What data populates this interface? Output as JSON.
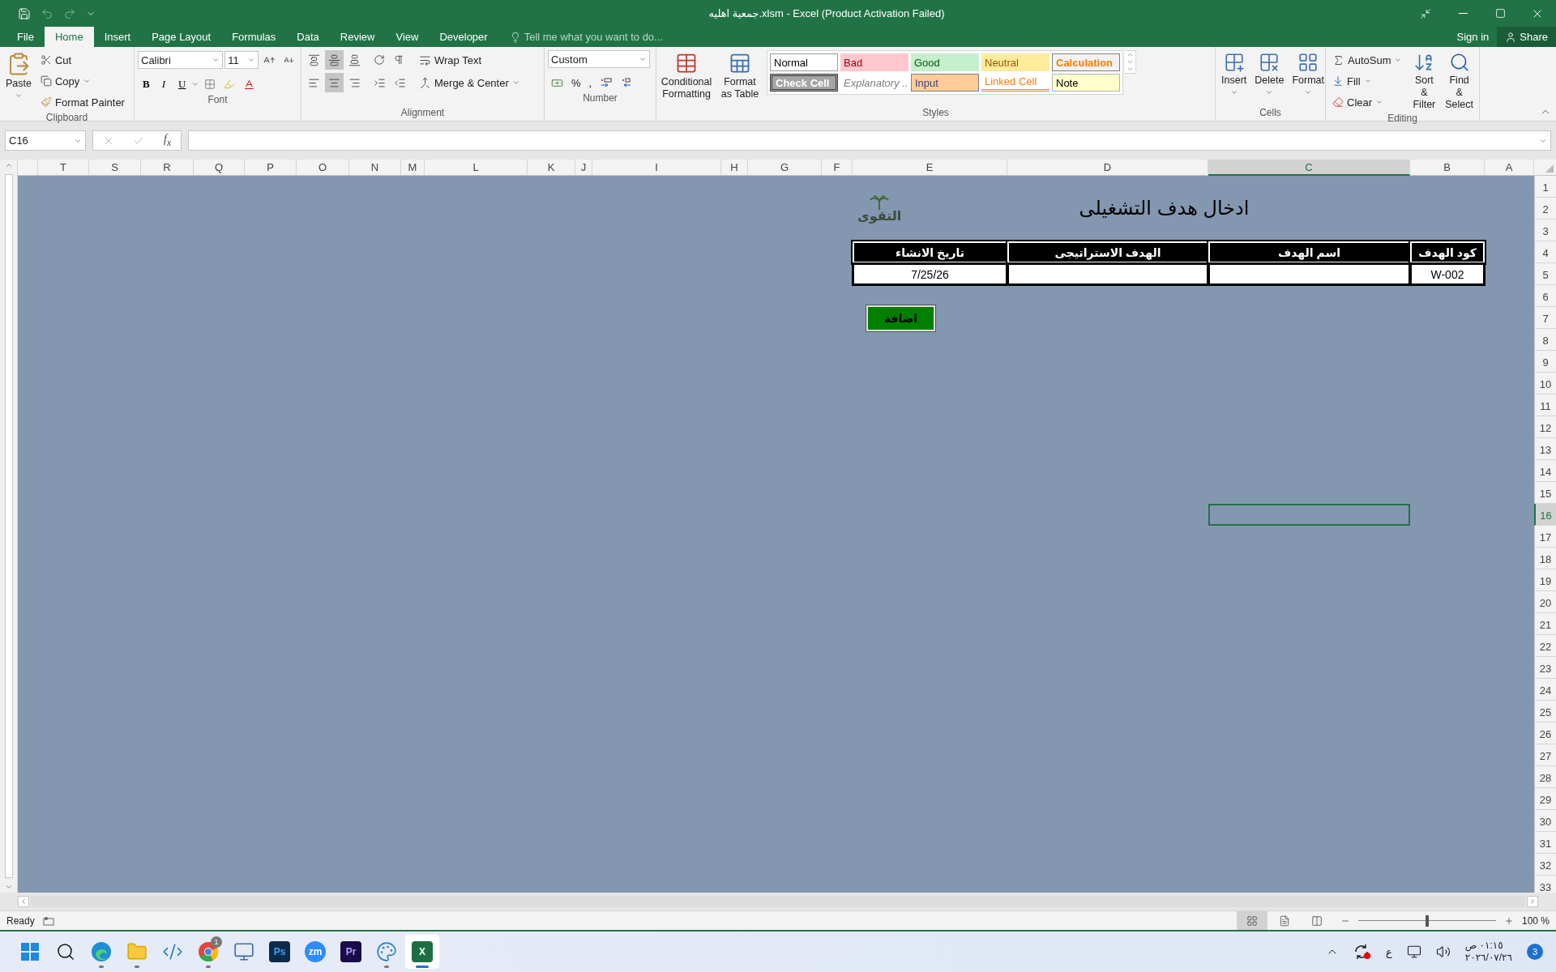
{
  "window": {
    "title": "جمعية اهليه.xlsm - Excel (Product Activation Failed)"
  },
  "quick_access": [
    {
      "kind": "save",
      "disabled": false
    },
    {
      "kind": "undo",
      "disabled": true
    },
    {
      "kind": "redo",
      "disabled": true
    },
    {
      "kind": "customize",
      "disabled": false
    }
  ],
  "ribbon_tabs": [
    {
      "label": "File",
      "selected": false
    },
    {
      "label": "Home",
      "selected": true
    },
    {
      "label": "Insert",
      "selected": false
    },
    {
      "label": "Page Layout",
      "selected": false
    },
    {
      "label": "Formulas",
      "selected": false
    },
    {
      "label": "Data",
      "selected": false
    },
    {
      "label": "Review",
      "selected": false
    },
    {
      "label": "View",
      "selected": false
    },
    {
      "label": "Developer",
      "selected": false
    }
  ],
  "tell_me": {
    "placeholder": "Tell me what you want to do..."
  },
  "account": {
    "sign_in": "Sign in",
    "share": "Share"
  },
  "ribbon": {
    "clipboard": {
      "label": "Clipboard",
      "paste": "Paste",
      "cut": "Cut",
      "copy": "Copy",
      "format_painter": "Format Painter"
    },
    "font": {
      "label": "Font",
      "name": "Calibri",
      "size": "11",
      "bold": "B",
      "italic": "I",
      "underline": "U"
    },
    "alignment": {
      "label": "Alignment",
      "wrap_text": "Wrap Text",
      "merge": "Merge & Center",
      "vertical": [
        {
          "kind": "top",
          "selected": false
        },
        {
          "kind": "middle",
          "selected": true
        },
        {
          "kind": "bottom",
          "selected": false
        }
      ],
      "horizontal": [
        {
          "kind": "left",
          "selected": false
        },
        {
          "kind": "center",
          "selected": true
        },
        {
          "kind": "right",
          "selected": false
        }
      ]
    },
    "number": {
      "label": "Number",
      "format": "Custom",
      "percent": "%",
      "comma": ","
    },
    "styles": {
      "label": "Styles",
      "conditional": "Conditional Formatting",
      "format_table": "Format as Table",
      "gallery": [
        {
          "label": "Normal",
          "kind": "normal"
        },
        {
          "label": "Bad",
          "kind": "bad"
        },
        {
          "label": "Good",
          "kind": "good"
        },
        {
          "label": "Neutral",
          "kind": "neutral"
        },
        {
          "label": "Calculation",
          "kind": "calculation"
        },
        {
          "label": "Check Cell",
          "kind": "check"
        },
        {
          "label": "Explanatory ...",
          "kind": "explanatory"
        },
        {
          "label": "Input",
          "kind": "input"
        },
        {
          "label": "Linked Cell",
          "kind": "linked"
        },
        {
          "label": "Note",
          "kind": "note"
        }
      ]
    },
    "cells": {
      "label": "Cells",
      "buttons": [
        {
          "label": "Insert",
          "kind": "insert"
        },
        {
          "label": "Delete",
          "kind": "delete"
        },
        {
          "label": "Format",
          "kind": "format"
        }
      ]
    },
    "editing": {
      "label": "Editing",
      "autosum": "AutoSum",
      "fill": "Fill",
      "clear": "Clear",
      "sort": "Sort & Filter",
      "find": "Find & Select"
    }
  },
  "formula_bar": {
    "name_box": "C16",
    "function": "f$_{x}$"
  },
  "sheet": {
    "columns": [
      {
        "letter": "T",
        "selected": false
      },
      {
        "letter": "S",
        "selected": false
      },
      {
        "letter": "R",
        "selected": false
      },
      {
        "letter": "Q",
        "selected": false
      },
      {
        "letter": "P",
        "selected": false
      },
      {
        "letter": "O",
        "selected": false
      },
      {
        "letter": "N",
        "selected": false
      },
      {
        "letter": "M",
        "selected": false
      },
      {
        "letter": "L",
        "selected": false
      },
      {
        "letter": "K",
        "selected": false
      },
      {
        "letter": "J",
        "selected": false
      },
      {
        "letter": "I",
        "selected": false
      },
      {
        "letter": "H",
        "selected": false
      },
      {
        "letter": "G",
        "selected": false
      },
      {
        "letter": "F",
        "selected": false
      },
      {
        "letter": "E",
        "selected": false
      },
      {
        "letter": "D",
        "selected": false
      },
      {
        "letter": "C",
        "selected": true
      },
      {
        "letter": "B",
        "selected": false
      },
      {
        "letter": "A",
        "selected": false
      }
    ],
    "rows": [
      {
        "number": "1",
        "selected": false
      },
      {
        "number": "2",
        "selected": false
      },
      {
        "number": "3",
        "selected": false
      },
      {
        "number": "4",
        "selected": false
      },
      {
        "number": "5",
        "selected": false
      },
      {
        "number": "6",
        "selected": false
      },
      {
        "number": "7",
        "selected": false
      },
      {
        "number": "8",
        "selected": false
      },
      {
        "number": "9",
        "selected": false
      },
      {
        "number": "10",
        "selected": false
      },
      {
        "number": "11",
        "selected": false
      },
      {
        "number": "12",
        "selected": false
      },
      {
        "number": "13",
        "selected": false
      },
      {
        "number": "14",
        "selected": false
      },
      {
        "number": "15",
        "selected": false
      },
      {
        "number": "16",
        "selected": true
      },
      {
        "number": "17",
        "selected": false
      },
      {
        "number": "18",
        "selected": false
      },
      {
        "number": "19",
        "selected": false
      },
      {
        "number": "20",
        "selected": false
      },
      {
        "number": "21",
        "selected": false
      },
      {
        "number": "22",
        "selected": false
      },
      {
        "number": "23",
        "selected": false
      },
      {
        "number": "24",
        "selected": false
      },
      {
        "number": "25",
        "selected": false
      },
      {
        "number": "26",
        "selected": false
      },
      {
        "number": "27",
        "selected": false
      },
      {
        "number": "28",
        "selected": false
      },
      {
        "number": "29",
        "selected": false
      },
      {
        "number": "30",
        "selected": false
      },
      {
        "number": "31",
        "selected": false
      },
      {
        "number": "32",
        "selected": false
      },
      {
        "number": "33",
        "selected": false
      }
    ],
    "title": "ادخال هدف التشغيلى",
    "logo": {
      "text": "التقوى"
    },
    "table": {
      "columns": [
        "تاريخ الانشاء",
        "الهدف الاستراتيجى",
        "اسم الهدف",
        "كود الهدف"
      ],
      "rows": [
        {
          "cells": [
            "7/25/26",
            null,
            null,
            "W-002"
          ]
        }
      ]
    },
    "button": "اضافة"
  },
  "status_bar": {
    "status": "Ready",
    "views": [
      {
        "kind": "normal",
        "selected": true
      },
      {
        "kind": "page_layout",
        "selected": false
      },
      {
        "kind": "page_break",
        "selected": false
      }
    ],
    "zoom": {
      "level": 0.5,
      "reading": "100 %"
    }
  },
  "taskbar": {
    "apps": [
      {
        "kind": "start",
        "running": false,
        "selected": false
      },
      {
        "kind": "search",
        "running": false,
        "selected": false
      },
      {
        "kind": "edge",
        "running": true,
        "selected": false
      },
      {
        "kind": "explorer",
        "running": true,
        "selected": false
      },
      {
        "kind": "vscode",
        "running": false,
        "selected": false
      },
      {
        "kind": "chrome",
        "running": true,
        "selected": false,
        "badge": "1"
      },
      {
        "kind": "remote",
        "running": false,
        "selected": false
      },
      {
        "kind": "photoshop",
        "running": false,
        "selected": false,
        "label": "Ps"
      },
      {
        "kind": "zoom",
        "running": false,
        "selected": false,
        "label": "zm"
      },
      {
        "kind": "premiere",
        "running": false,
        "selected": false,
        "label": "Pr"
      },
      {
        "kind": "paint",
        "running": true,
        "selected": false
      },
      {
        "kind": "excel",
        "running": true,
        "selected": true,
        "label": "X"
      }
    ],
    "tray": {
      "language": "ع",
      "time": "٠١:١٥ ص",
      "date": "٢٠٢٦/٠٧/٢٦",
      "notifications": "3"
    }
  }
}
